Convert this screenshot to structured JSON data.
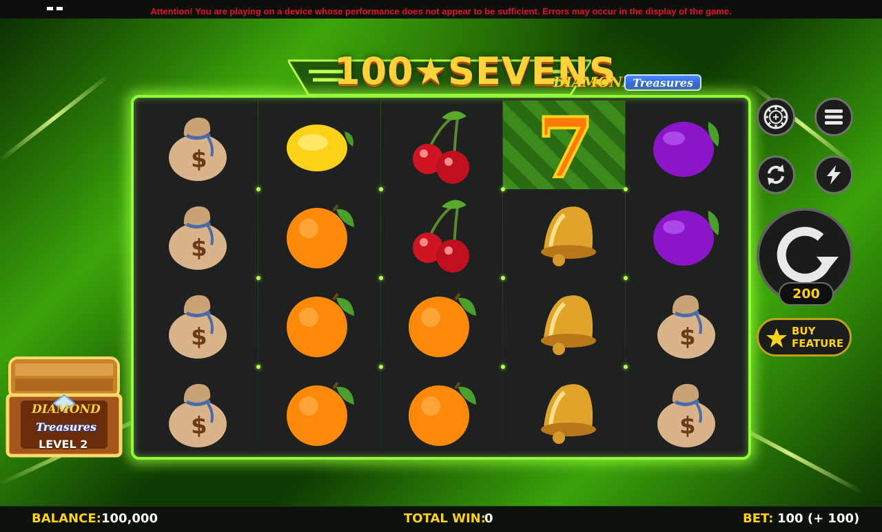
{
  "warning": "Attention! You are playing on a device whose performance does not appear to be sufficient. Errors may occur in the display of the game.",
  "logo": {
    "title": "100★SEVENS",
    "subtitle_1": "DIAMOND",
    "subtitle_2": "Treasures"
  },
  "reels": [
    [
      "money-bag",
      "money-bag",
      "money-bag",
      "money-bag"
    ],
    [
      "lemon",
      "orange",
      "orange",
      "orange"
    ],
    [
      "cherry",
      "cherry",
      "orange",
      "orange"
    ],
    [
      "seven",
      "bell",
      "bell",
      "bell"
    ],
    [
      "plum",
      "plum",
      "money-bag",
      "money-bag"
    ]
  ],
  "highlighted_cell": {
    "reel": 4,
    "row": 1
  },
  "controls": {
    "autoplay_count": "200",
    "buy_feature_line1": "BUY",
    "buy_feature_line2": "FEATURE"
  },
  "chest": {
    "line1": "DIAMOND",
    "line2": "Treasures",
    "level": "LEVEL 2"
  },
  "footer": {
    "balance_label": "BALANCE:",
    "balance_value": "100,000",
    "total_win_label": "TOTAL WIN:",
    "total_win_value": "0",
    "bet_label": "BET:",
    "bet_value": "100 (+ 100)"
  },
  "colors": {
    "accent_gold": "#ffd21a",
    "frame_green": "#8cff3a",
    "warning_red": "#e0142a"
  }
}
